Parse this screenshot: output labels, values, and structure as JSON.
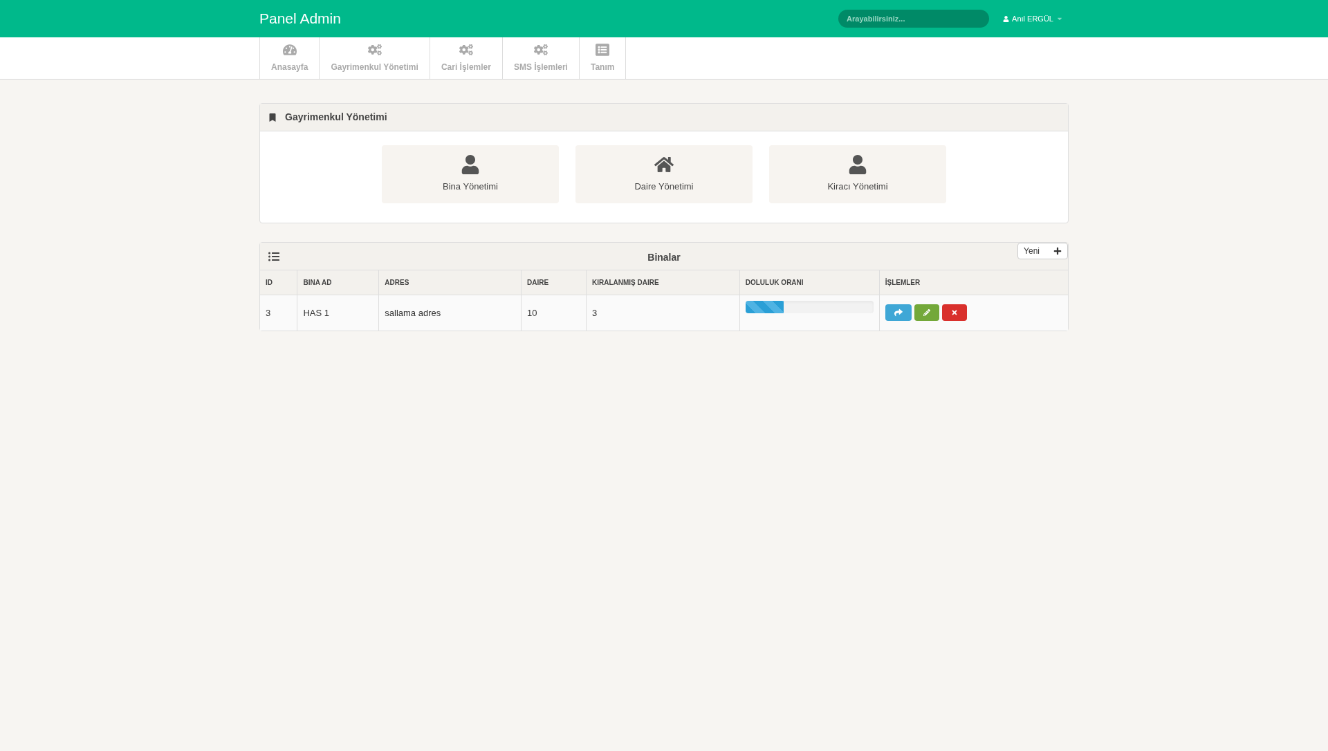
{
  "brand": "Panel Admin",
  "search": {
    "placeholder": "Arayabilirsiniz..."
  },
  "user": {
    "name": "Anıl ERGÜL"
  },
  "nav": [
    {
      "label": "Anasayfa",
      "kind": "dashboard"
    },
    {
      "label": "Gayrimenkul Yönetimi",
      "kind": "gears"
    },
    {
      "label": "Cari İşlemler",
      "kind": "gears"
    },
    {
      "label": "SMS İşlemleri",
      "kind": "gears"
    },
    {
      "label": "Tanım",
      "kind": "list"
    }
  ],
  "management": {
    "title": "Gayrimenkul Yönetimi",
    "tiles": [
      {
        "label": "Bina Yönetimi",
        "kind": "user"
      },
      {
        "label": "Daire Yönetimi",
        "kind": "home"
      },
      {
        "label": "Kiracı Yönetimi",
        "kind": "user"
      }
    ]
  },
  "buildings": {
    "title": "Binalar",
    "new_button": "Yeni",
    "columns": [
      "ID",
      "BINA AD",
      "ADRES",
      "DAIRE",
      "KIRALANMIŞ DAIRE",
      "DOLULUK ORANI",
      "İŞLEMLER"
    ],
    "rows": [
      {
        "id": "3",
        "name": "HAS 1",
        "address": "sallama adres",
        "flats": "10",
        "rented": "3",
        "level": 0.3
      }
    ]
  }
}
